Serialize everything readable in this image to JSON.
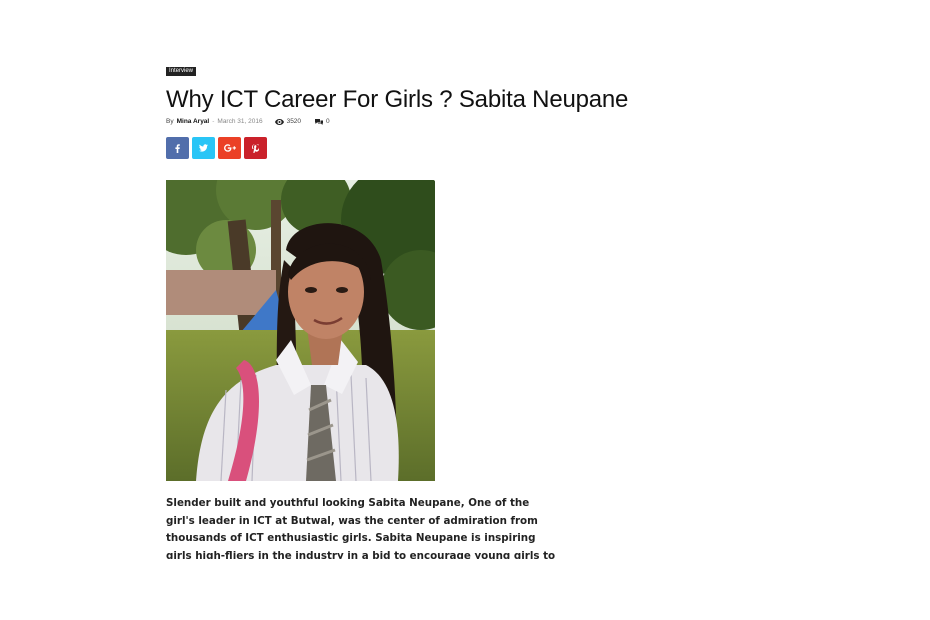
{
  "article": {
    "category": "Interview",
    "title": "Why ICT Career For Girls ? Sabita Neupane",
    "by_label": "By",
    "author": "Mina Aryal",
    "separator": "-",
    "date": "March 31, 2016",
    "views": "3520",
    "comments": "0",
    "excerpt": "Slender built and youthful looking Sabita Neupane, One of the girl's leader in ICT at Butwal, was the center of admiration from thousands of ICT enthusiastic girls. Sabita Neupane is inspiring girls high-fliers in the industry in a bid to encourage young girls to take an interest in the IT sector."
  },
  "share": {
    "facebook_icon": "f",
    "twitter_icon": "twitter-bird",
    "googleplus_icon": "G+",
    "pinterest_icon": "pinterest-p"
  },
  "colors": {
    "facebook": "#516eab",
    "twitter": "#29c5f6",
    "googleplus": "#eb4026",
    "pinterest": "#ca212a",
    "category_bg": "#222222"
  }
}
